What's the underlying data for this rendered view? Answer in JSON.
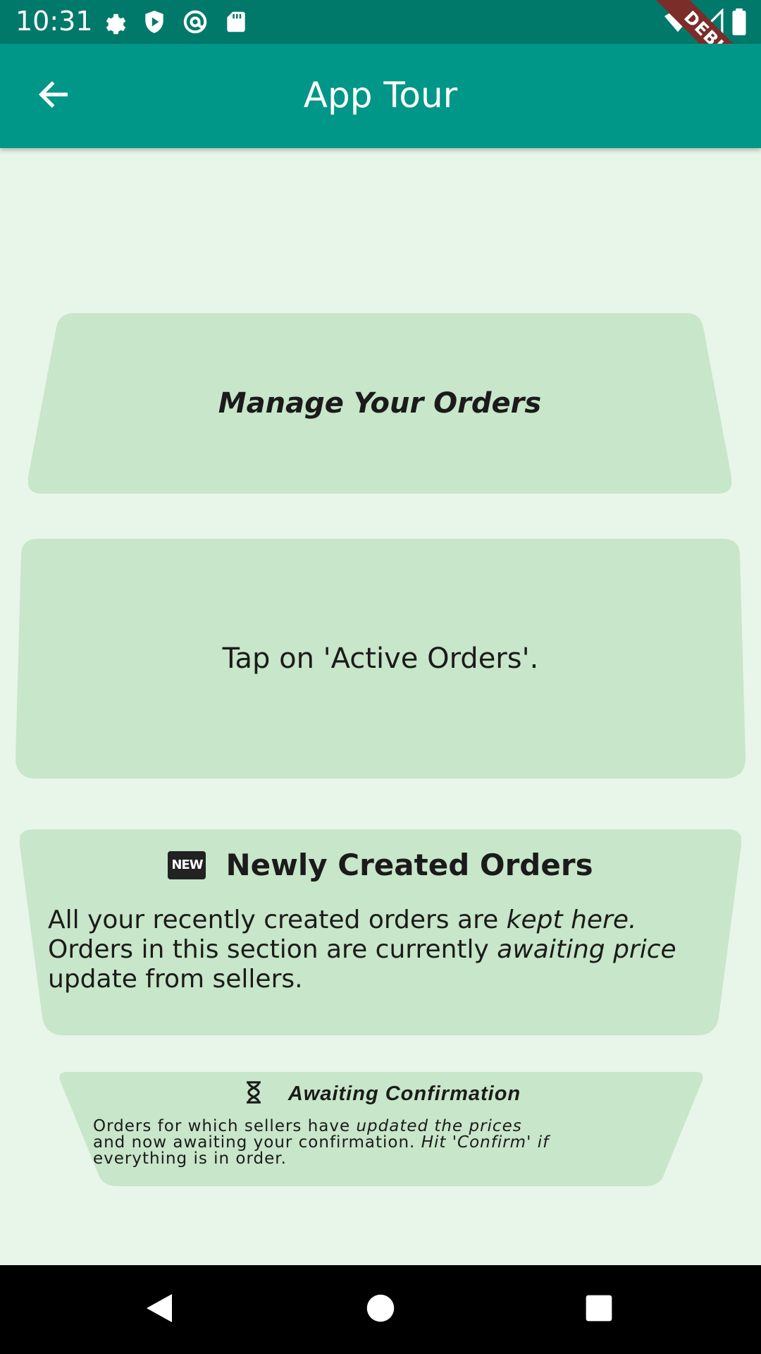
{
  "status_bar": {
    "time": "10:31",
    "left_icons": [
      "gear-icon",
      "shield-icon",
      "at-sign-icon",
      "sd-card-icon"
    ],
    "right_icons": [
      "wifi-icon",
      "signal-icon",
      "battery-icon"
    ],
    "debug_label": "DEBUG"
  },
  "app_bar": {
    "title": "App Tour",
    "back_icon": "arrow-left-icon",
    "background": "#009688",
    "status_background": "#00796b"
  },
  "cards": {
    "manage": {
      "title": "Manage Your Orders"
    },
    "tap": {
      "text": "Tap on 'Active Orders'."
    },
    "newly_created": {
      "icon_label": "NEW",
      "title": "Newly Created Orders",
      "line1_a": "All your recently created orders are ",
      "line1_b": "kept here.",
      "line2_a": " Orders in this section are currently ",
      "line2_b": "awaiting price",
      "line3": " update from sellers."
    },
    "awaiting": {
      "icon": "hourglass-icon",
      "title": "Awaiting Confirmation",
      "line1_a": "Orders for which sellers have ",
      "line1_b": "updated the prices",
      "line2_a": " and now awaiting your confirmation. ",
      "line2_b": "Hit 'Confirm' if",
      "line3": " everything is in order."
    },
    "card_color": "#c8e6c9",
    "page_background": "#e8f5e9"
  },
  "nav_bar": {
    "back_icon": "triangle-back-icon",
    "home_icon": "circle-home-icon",
    "recents_icon": "square-recents-icon"
  }
}
